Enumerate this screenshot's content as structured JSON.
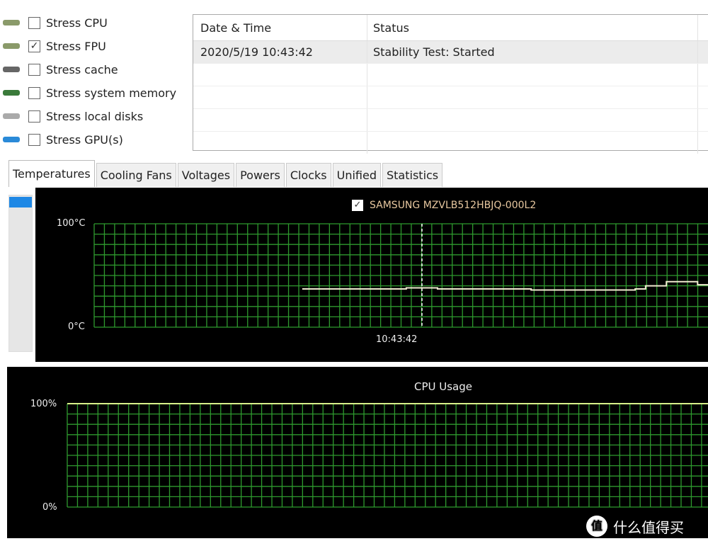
{
  "stress_options": [
    {
      "label": "Stress CPU",
      "checked": false,
      "icon": "cpu-icon"
    },
    {
      "label": "Stress FPU",
      "checked": true,
      "icon": "fpu-icon"
    },
    {
      "label": "Stress cache",
      "checked": false,
      "icon": "cache-icon"
    },
    {
      "label": "Stress system memory",
      "checked": false,
      "icon": "memory-icon"
    },
    {
      "label": "Stress local disks",
      "checked": false,
      "icon": "disk-icon"
    },
    {
      "label": "Stress GPU(s)",
      "checked": false,
      "icon": "gpu-icon"
    }
  ],
  "log": {
    "headers": [
      "Date & Time",
      "Status"
    ],
    "rows": [
      [
        "2020/5/19 10:43:42",
        "Stability Test: Started"
      ]
    ]
  },
  "tabs": [
    "Temperatures",
    "Cooling Fans",
    "Voltages",
    "Powers",
    "Clocks",
    "Unified",
    "Statistics"
  ],
  "active_tab": "Temperatures",
  "chart_data": [
    {
      "type": "line",
      "legend": [
        {
          "label": "SAMSUNG MZVLB512HBJQ-000L2",
          "checked": true
        }
      ],
      "ytick_labels": [
        "100°C",
        "0°C"
      ],
      "ylim": [
        0,
        100
      ],
      "marker_label": "10:43:42",
      "grid": true,
      "series": [
        {
          "name": "SAMSUNG MZVLB512HBJQ-000L2",
          "color": "#f0ead0",
          "values": [
            null,
            null,
            null,
            null,
            null,
            null,
            null,
            null,
            null,
            null,
            null,
            null,
            null,
            null,
            null,
            null,
            null,
            null,
            null,
            null,
            37,
            37,
            37,
            37,
            37,
            37,
            37,
            37,
            37,
            37,
            38,
            38,
            38,
            37,
            37,
            37,
            37,
            37,
            37,
            37,
            37,
            37,
            36,
            36,
            36,
            36,
            36,
            36,
            36,
            36,
            36,
            36,
            37,
            40,
            40,
            44,
            44,
            44,
            41,
            41
          ]
        }
      ]
    },
    {
      "type": "line",
      "title": "CPU Usage",
      "ytick_labels": [
        "100%",
        "0%"
      ],
      "ylim": [
        0,
        100
      ],
      "grid": true,
      "series": [
        {
          "color": "#d8f08a",
          "values": [
            100,
            100
          ]
        }
      ]
    }
  ],
  "colors": {
    "grid": "#2e9a2e",
    "background": "#000000",
    "slider_thumb": "#1e88e5"
  },
  "watermark": "什么值得买"
}
